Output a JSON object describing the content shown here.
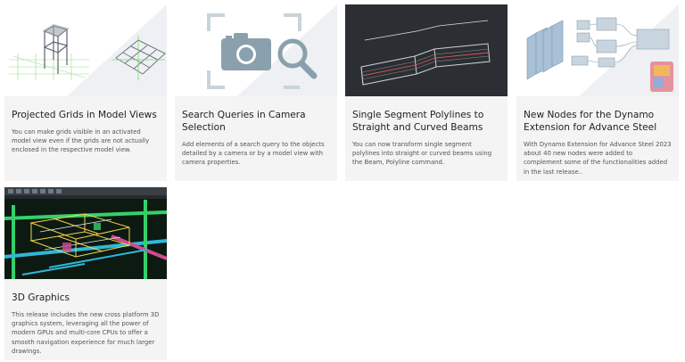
{
  "cards": [
    {
      "title": "Projected Grids in Model Views",
      "description": "You can make grids visible in an activated model view even if the grids are not actually enclosed in the respective model view."
    },
    {
      "title": "Search Queries in Camera Selection",
      "description": "Add elements of a search query to the objects detailed by a camera or by a model view with camera properties."
    },
    {
      "title": "Single Segment Polylines to Straight and Curved Beams",
      "description": "You can now transform single segment polylines into straight or curved beams using the Beam, Polyline command."
    },
    {
      "title": "New Nodes for the Dynamo Extension for Advance Steel",
      "description": "With Dynamo Extension for Advance Steel 2023 about 40 new nodes were added to complement some of the functionalities added in the last release.."
    },
    {
      "title": "3D Graphics",
      "description": "This release includes the new cross platform 3D graphics system, leveraging all the power of modern GPUs and multi-core CPUs to offer a smooth navigation experience for much larger drawings."
    }
  ],
  "colors": {
    "card_background": "#f4f4f4",
    "title_text": "#222222",
    "description_text": "#555555",
    "camera_icon": "#8aa0ad",
    "dark_thumb_background": "#2b2f33"
  },
  "icons": [
    "camera-icon",
    "magnifier-icon"
  ]
}
